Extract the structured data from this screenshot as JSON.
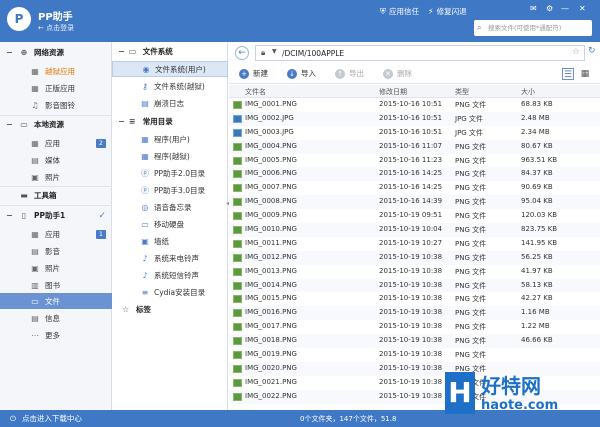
{
  "app": {
    "logo": "P",
    "title": "PP助手",
    "subtitle": "← 点击登录"
  },
  "topbar": {
    "trust": "应用信任",
    "flash": "修复闪退",
    "search_placeholder": "搜索文件(可使用*通配符)"
  },
  "left_nav": {
    "sections": [
      {
        "label": "网络资源",
        "items": [
          {
            "label": "越狱应用",
            "highlight": true
          },
          {
            "label": "正版应用"
          },
          {
            "label": "影音图铃"
          }
        ]
      },
      {
        "label": "本地资源",
        "items": [
          {
            "label": "应用",
            "badge": "2"
          },
          {
            "label": "媒体"
          },
          {
            "label": "照片"
          }
        ]
      },
      {
        "label": "工具箱",
        "items": []
      },
      {
        "label": "PP助手1",
        "items": [
          {
            "label": "应用",
            "badge": "1"
          },
          {
            "label": "影音"
          },
          {
            "label": "照片"
          },
          {
            "label": "图书"
          },
          {
            "label": "文件",
            "active": true
          },
          {
            "label": "信息"
          },
          {
            "label": "更多"
          }
        ]
      }
    ]
  },
  "middle_nav": {
    "filesystem": {
      "label": "文件系统",
      "items": [
        "文件系统(用户)",
        "文件系统(越狱)",
        "崩溃日志"
      ]
    },
    "common": {
      "label": "常用目录",
      "items": [
        "程序(用户)",
        "程序(越狱)",
        "PP助手2.0目录",
        "PP助手3.0目录",
        "语音备忘录",
        "移动硬盘",
        "墙纸",
        "系统来电铃声",
        "系统短信铃声",
        "Cydia安装目录"
      ]
    },
    "tags": {
      "label": "标签"
    }
  },
  "pathbar": {
    "path": "/DCIM/100APPLE"
  },
  "toolbar": {
    "new": "新建",
    "import": "导入",
    "export": "导出",
    "delete": "删除"
  },
  "table": {
    "headers": {
      "name": "文件名",
      "date": "修改日期",
      "type": "类型",
      "size": "大小"
    },
    "rows": [
      {
        "name": "IMG_0001.PNG",
        "date": "2015-10-16 10:51",
        "type": "PNG 文件",
        "size": "68.83 KB"
      },
      {
        "name": "IMG_0002.JPG",
        "date": "2015-10-16 10:51",
        "type": "JPG 文件",
        "size": "2.48 MB"
      },
      {
        "name": "IMG_0003.JPG",
        "date": "2015-10-16 10:51",
        "type": "JPG 文件",
        "size": "2.34 MB"
      },
      {
        "name": "IMG_0004.PNG",
        "date": "2015-10-16 11:07",
        "type": "PNG 文件",
        "size": "80.67 KB"
      },
      {
        "name": "IMG_0005.PNG",
        "date": "2015-10-16 11:23",
        "type": "PNG 文件",
        "size": "963.51 KB"
      },
      {
        "name": "IMG_0006.PNG",
        "date": "2015-10-16 14:25",
        "type": "PNG 文件",
        "size": "84.37 KB"
      },
      {
        "name": "IMG_0007.PNG",
        "date": "2015-10-16 14:25",
        "type": "PNG 文件",
        "size": "90.69 KB"
      },
      {
        "name": "IMG_0008.PNG",
        "date": "2015-10-16 14:39",
        "type": "PNG 文件",
        "size": "95.04 KB"
      },
      {
        "name": "IMG_0009.PNG",
        "date": "2015-10-19 09:51",
        "type": "PNG 文件",
        "size": "120.03 KB"
      },
      {
        "name": "IMG_0010.PNG",
        "date": "2015-10-19 10:04",
        "type": "PNG 文件",
        "size": "823.75 KB"
      },
      {
        "name": "IMG_0011.PNG",
        "date": "2015-10-19 10:27",
        "type": "PNG 文件",
        "size": "141.95 KB"
      },
      {
        "name": "IMG_0012.PNG",
        "date": "2015-10-19 10:38",
        "type": "PNG 文件",
        "size": "56.25 KB"
      },
      {
        "name": "IMG_0013.PNG",
        "date": "2015-10-19 10:38",
        "type": "PNG 文件",
        "size": "41.97 KB"
      },
      {
        "name": "IMG_0014.PNG",
        "date": "2015-10-19 10:38",
        "type": "PNG 文件",
        "size": "58.13 KB"
      },
      {
        "name": "IMG_0015.PNG",
        "date": "2015-10-19 10:38",
        "type": "PNG 文件",
        "size": "42.27 KB"
      },
      {
        "name": "IMG_0016.PNG",
        "date": "2015-10-19 10:38",
        "type": "PNG 文件",
        "size": "1.16 MB"
      },
      {
        "name": "IMG_0017.PNG",
        "date": "2015-10-19 10:38",
        "type": "PNG 文件",
        "size": "1.22 MB"
      },
      {
        "name": "IMG_0018.PNG",
        "date": "2015-10-19 10:38",
        "type": "PNG 文件",
        "size": "46.66 KB"
      },
      {
        "name": "IMG_0019.PNG",
        "date": "2015-10-19 10:38",
        "type": "PNG 文件",
        "size": ""
      },
      {
        "name": "IMG_0020.PNG",
        "date": "2015-10-19 10:38",
        "type": "PNG 文件",
        "size": ""
      },
      {
        "name": "IMG_0021.PNG",
        "date": "2015-10-19 10:38",
        "type": "PNG 文件",
        "size": ""
      },
      {
        "name": "IMG_0022.PNG",
        "date": "2015-10-19 10:38",
        "type": "PNG 文件",
        "size": ""
      }
    ]
  },
  "statusbar": {
    "download": "点击进入下载中心",
    "count": "0个文件夹，147个文件，51.8"
  },
  "watermark": {
    "logo": "H",
    "cn": "好特网",
    "en": "haote.com"
  }
}
